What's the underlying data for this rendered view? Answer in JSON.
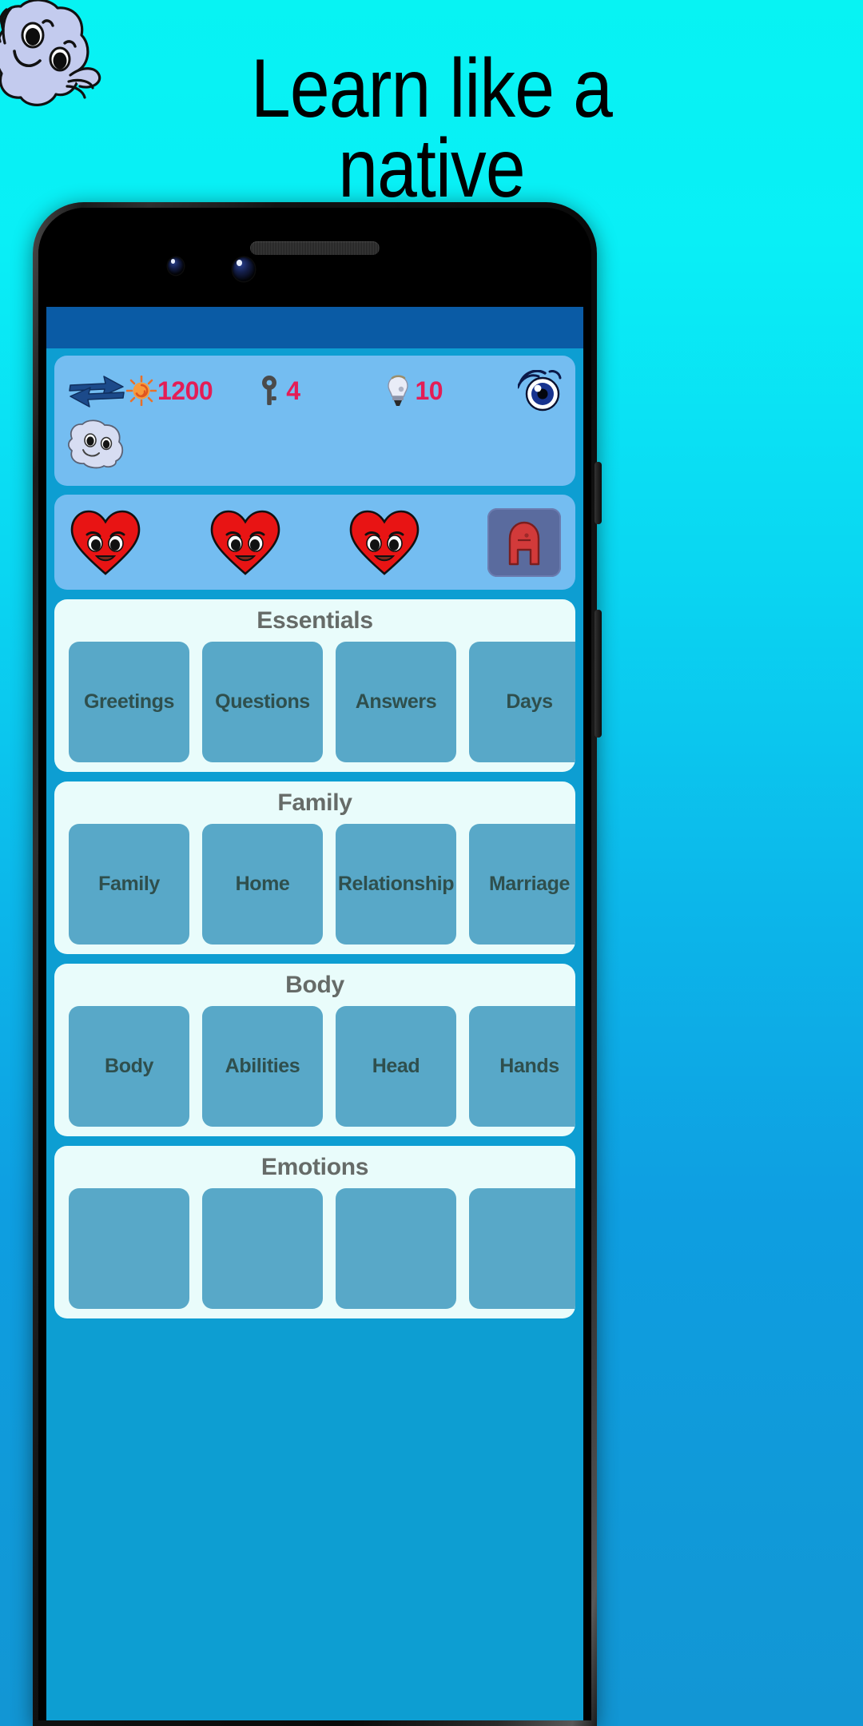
{
  "hero": {
    "title_line1": "Learn like a",
    "title_line2": "native",
    "mascot_icon": "cloud-mascot-icon"
  },
  "phone": {
    "speaker_icon": "speaker-grille-icon",
    "camera_icon": "front-camera-icon"
  },
  "app": {
    "stats": {
      "swap_icon": "swap-arrows-icon",
      "sun_icon": "sun-icon",
      "sun_value": "1200",
      "key_icon": "key-icon",
      "key_value": "4",
      "bulb_icon": "lightbulb-icon",
      "bulb_value": "10",
      "eye_icon": "eye-icon",
      "mascot_icon": "cloud-mascot-icon",
      "value_color": "#e41d56",
      "panel_color": "#74bdf1"
    },
    "lives": {
      "heart_icon": "heart-face-icon",
      "hearts_count": 3,
      "letter_tile_label": "A",
      "letter_tile_icon": "letter-a-tile-icon"
    },
    "categories": [
      {
        "title": "Essentials",
        "tiles": [
          "Greetings",
          "Questions",
          "Answers",
          "Days"
        ]
      },
      {
        "title": "Family",
        "tiles": [
          "Family",
          "Home",
          "Relationship",
          "Marriage"
        ]
      },
      {
        "title": "Body",
        "tiles": [
          "Body",
          "Abilities",
          "Head",
          "Hands"
        ]
      },
      {
        "title": "Emotions",
        "tiles": [
          "",
          "",
          "",
          ""
        ]
      }
    ],
    "colors": {
      "appbar": "#0a5ba5",
      "screen_bg": "#0d9ed2",
      "card_bg": "#e9fcfb",
      "tile_bg": "#58a8c8",
      "tile_text": "#2f4f4d",
      "card_title": "#666b68"
    }
  }
}
